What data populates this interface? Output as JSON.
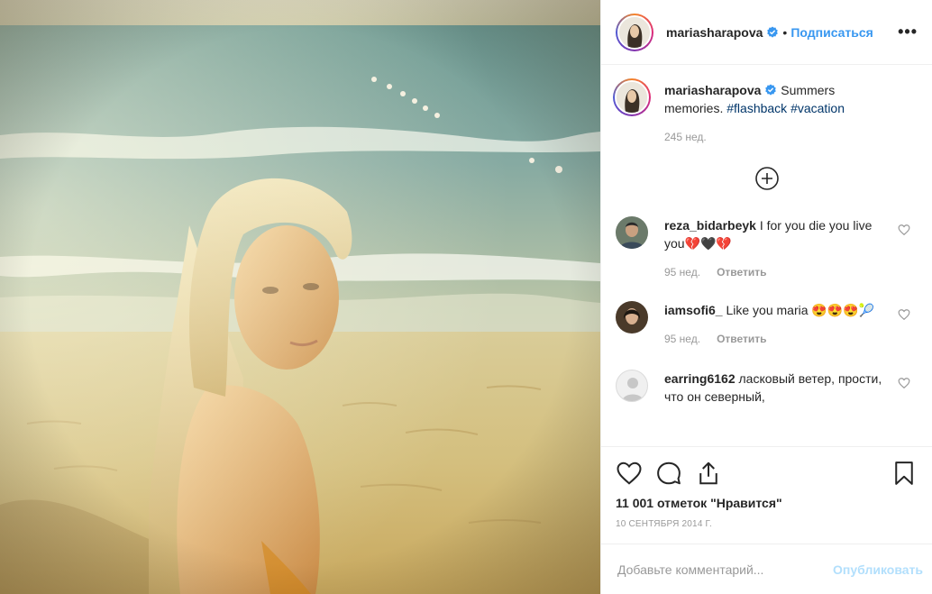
{
  "post": {
    "image_alt": "Woman with blonde hair on a sandy beach at sunset, sea waves behind"
  },
  "header": {
    "username": "mariasharapova",
    "dot": "•",
    "follow_label": "Подписаться",
    "more_label": "•••"
  },
  "caption": {
    "username": "mariasharapova",
    "text": "Summers memories.",
    "hashtags": [
      "#flashback",
      "#vacation"
    ],
    "time": "245 нед."
  },
  "comments": [
    {
      "username": "reza_bidarbeyk",
      "text": "I for you die you live you💔🖤💔",
      "time": "95 нед.",
      "reply": "Ответить"
    },
    {
      "username": "iamsofi6_",
      "text": "Like you maria 😍😍😍🎾",
      "time": "95 нед.",
      "reply": "Ответить"
    },
    {
      "username": "earring6162",
      "text": "ласковый ветер, прости, что он северный,",
      "time": "",
      "reply": ""
    }
  ],
  "likes": {
    "text": "11 001 отметок \"Нравится\""
  },
  "date": "10 сентября 2014 г.",
  "add_comment": {
    "placeholder": "Добавьте комментарий...",
    "publish_label": "Опубликовать"
  },
  "colors": {
    "link": "#3897f0",
    "hashtag": "#003569",
    "muted": "#999999",
    "publish_disabled": "#b2dffc"
  }
}
